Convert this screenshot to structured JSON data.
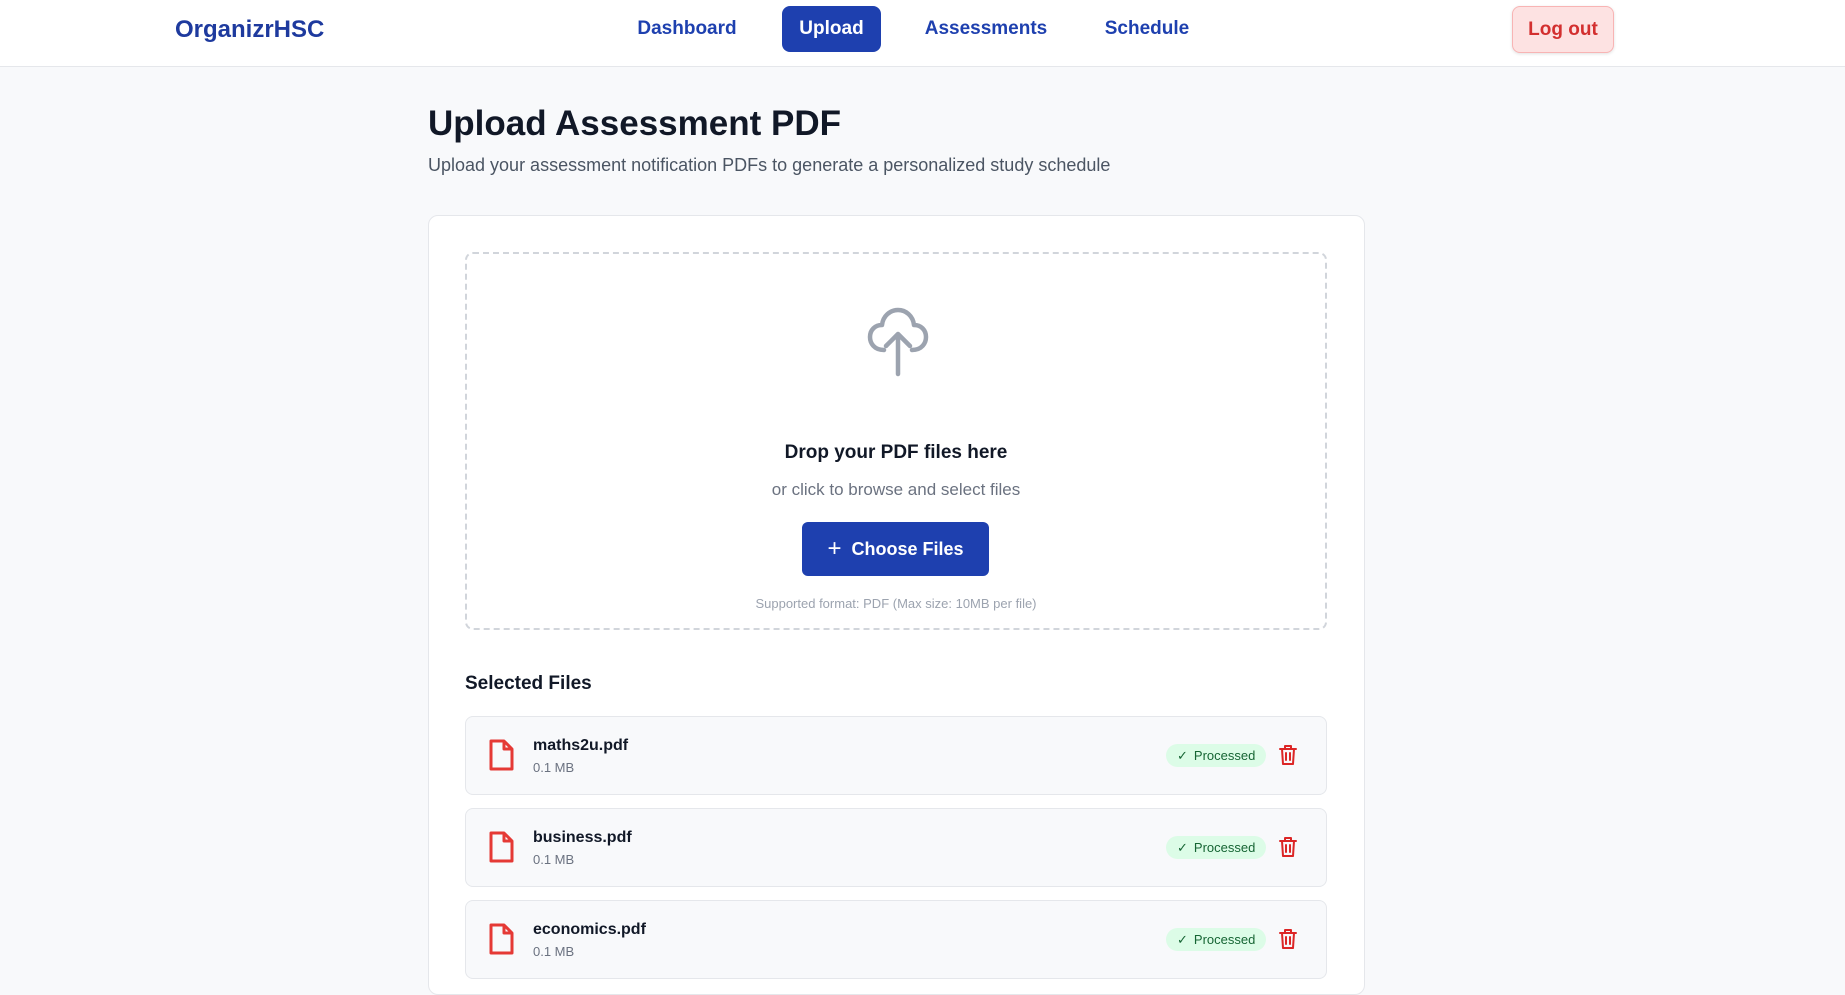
{
  "nav": {
    "brand": "OrganizrHSC",
    "links": [
      {
        "label": "Dashboard",
        "active": false
      },
      {
        "label": "Upload",
        "active": true
      },
      {
        "label": "Assessments",
        "active": false
      },
      {
        "label": "Schedule",
        "active": false
      }
    ],
    "logout_label": "Log out"
  },
  "header": {
    "title": "Upload Assessment PDF",
    "subtitle": "Upload your assessment notification PDFs to generate a personalized study schedule"
  },
  "dropzone": {
    "icon": "cloud-upload-icon",
    "title": "Drop your PDF files here",
    "subtitle": "or click to browse and select files",
    "button_label": "Choose Files",
    "button_icon": "plus-icon",
    "note": "Supported format: PDF (Max size: 10MB per file)"
  },
  "files": {
    "section_title": "Selected Files",
    "items": [
      {
        "name": "maths2u.pdf",
        "size": "0.1 MB",
        "status": "Processed"
      },
      {
        "name": "business.pdf",
        "size": "0.1 MB",
        "status": "Processed"
      },
      {
        "name": "economics.pdf",
        "size": "0.1 MB",
        "status": "Processed"
      }
    ]
  },
  "colors": {
    "primary": "#1e40af",
    "logout_bg": "#fde2e2",
    "logout_text": "#d32f2f",
    "success_bg": "#dcfce7",
    "success_text": "#166534",
    "file_icon": "#e53935",
    "trash_icon": "#dc2626"
  }
}
